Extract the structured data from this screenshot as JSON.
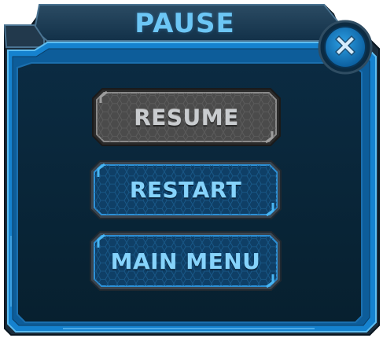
{
  "dialog": {
    "title": "PAUSE",
    "close_icon": "close-x-icon"
  },
  "buttons": {
    "resume": "RESUME",
    "restart": "RESTART",
    "main_menu": "MAIN MENU"
  },
  "colors": {
    "panel_fill": "#082437",
    "frame_blue": "#1a8ad6",
    "title_text": "#6cc6f5",
    "button_active_text": "#86d3fb",
    "button_disabled_text": "#c9cccf"
  }
}
